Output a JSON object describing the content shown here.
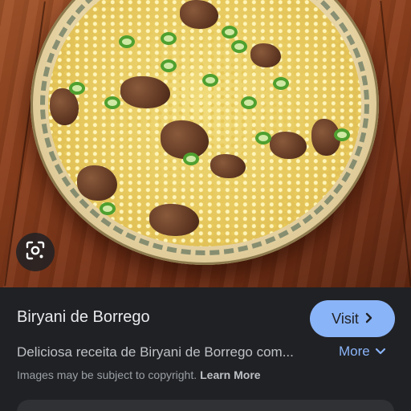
{
  "image": {
    "alt": "",
    "lens_icon": "google-lens-icon"
  },
  "result": {
    "title": "Biryani de Borrego",
    "visit_label": "Visit",
    "visit_icon": "chevron-right-icon",
    "description": "Deliciosa receita de Biryani de Borrego com...",
    "more_label": "More",
    "more_icon": "chevron-down-icon",
    "copyright_text": "Images may be subject to copyright.",
    "learn_more_label": "Learn More"
  },
  "colors": {
    "panel_bg": "#202124",
    "accent": "#8ab4f8",
    "primary_text": "#e8eaed",
    "secondary_text": "#bdc1c6"
  }
}
